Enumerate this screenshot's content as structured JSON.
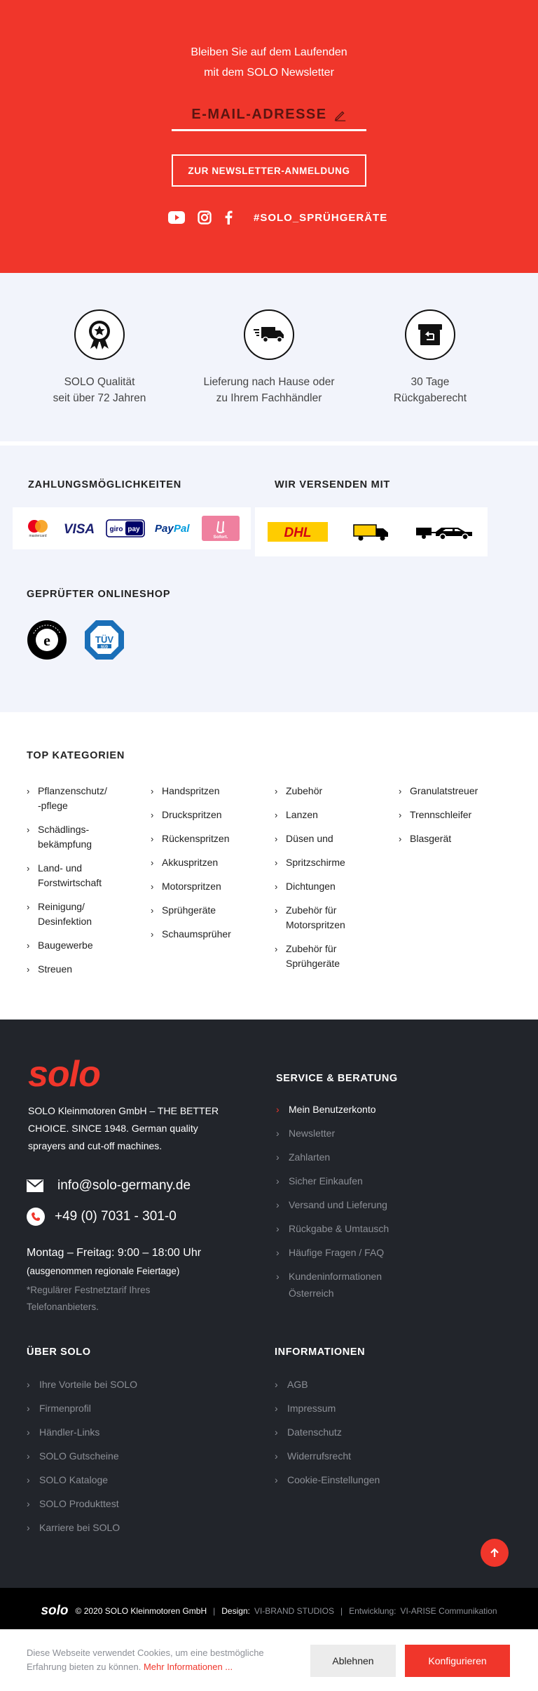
{
  "colors": {
    "brand_red": "#f0362b",
    "footer_bg": "#22252b",
    "light_bg": "#f2f4fb"
  },
  "newsletter": {
    "line1": "Bleiben Sie auf dem Laufenden",
    "line2": "mit dem SOLO Newsletter",
    "email_placeholder": "E-MAIL-ADRESSE",
    "submit_label": "ZUR NEWSLETTER-ANMELDUNG",
    "hashtag": "#SOLO_SPRÜHGERÄTE",
    "social_icons": [
      "youtube-icon",
      "instagram-icon",
      "facebook-icon"
    ]
  },
  "features": [
    {
      "icon": "award-medal-icon",
      "line1": "SOLO Qualität",
      "line2": "seit über 72 Jahren"
    },
    {
      "icon": "delivery-truck-icon",
      "line1": "Lieferung nach Hause oder",
      "line2": "zu Ihrem Fachhändler"
    },
    {
      "icon": "return-box-icon",
      "line1": "30 Tage",
      "line2": "Rückgaberecht"
    }
  ],
  "payments": {
    "heading": "ZAHLUNGSMÖGLICHKEITEN",
    "methods": [
      "mastercard",
      "VISA",
      "giropay",
      "PayPal",
      "Sofort."
    ]
  },
  "shipping": {
    "heading": "WIR VERSENDEN MIT",
    "carriers": [
      "DHL",
      "Spedition",
      "Fahrzeug mit Anhänger"
    ]
  },
  "shop": {
    "heading": "GEPRÜFTER ONLINESHOP",
    "badges": [
      "Trusted Shops Guarantee",
      "TÜV SÜD"
    ]
  },
  "categories": {
    "heading": "TOP KATEGORIEN",
    "col1": [
      "Pflanzenschutz/\n-pflege",
      "Schädlings-\nbekämpfung",
      "Land- und\nForstwirtschaft",
      "Reinigung/\nDesinfektion",
      "Baugewerbe",
      "Streuen"
    ],
    "col2": [
      "Handspritzen",
      "Drucksprit​zen",
      "Rückenspritzen",
      "Akkuspritzen",
      "Motorspritzen",
      "Sprühgeräte",
      "Schaumsprüher"
    ],
    "col3": [
      "Zubehör",
      "Lanzen",
      "Düsen und",
      "Spritzschirme",
      "Dichtungen",
      "Zubehör für\nMotorspritzen",
      "Zubehör für\nSprühgeräte"
    ],
    "col4": [
      "Granulatstreuer",
      "Trennschleifer",
      "Blasgerät"
    ]
  },
  "footer": {
    "logo": "solo",
    "about": "SOLO Kleinmotoren GmbH – THE BETTER CHOICE. SINCE 1948. German quality sprayers and cut-off machines.",
    "email": "info@solo-germany.de",
    "phone": "+49 (0) 7031 - 301-0",
    "hours": "Montag – Freitag: 9:00 – 18:00 Uhr",
    "hours_note": "(ausgenommen regionale Feiertage)",
    "tariff_note": "*Regulärer Festnetztarif Ihres Telefonanbieters.",
    "service": {
      "heading": "SERVICE & BERATUNG",
      "items": [
        "Mein Benutzerkonto",
        "Newsletter",
        "Zahlarten",
        "Sicher Einkaufen",
        "Versand und Lieferung",
        "Rückgabe & Umtausch",
        "Häufige Fragen / FAQ",
        "Kundeninformationen Österreich"
      ]
    },
    "about_solo": {
      "heading": "ÜBER SOLO",
      "items": [
        "Ihre Vorteile bei SOLO",
        "Firmenprofil",
        "Händler-Links",
        "SOLO Gutscheine",
        "SOLO Kataloge",
        "SOLO Produkttest",
        "Karriere bei SOLO"
      ]
    },
    "info": {
      "heading": "INFORMATIONEN",
      "items": [
        "AGB",
        "Impressum",
        "Datenschutz",
        "Widerrufsrecht",
        "Cookie-Einstellungen"
      ]
    }
  },
  "copyright": {
    "logo": "solo",
    "text": "© 2020 SOLO Kleinmotoren GmbH",
    "design_label": "Design:",
    "design_value": "VI-BRAND STUDIOS",
    "dev_label": "Entwicklung:",
    "dev_value": "VI-ARISE Communikation"
  },
  "cookie": {
    "text": "Diese Webseite verwendet Cookies, um eine bestmögliche Erfahrung bieten zu können.",
    "link": "Mehr Informationen ...",
    "decline": "Ablehnen",
    "configure": "Konfigurieren"
  }
}
